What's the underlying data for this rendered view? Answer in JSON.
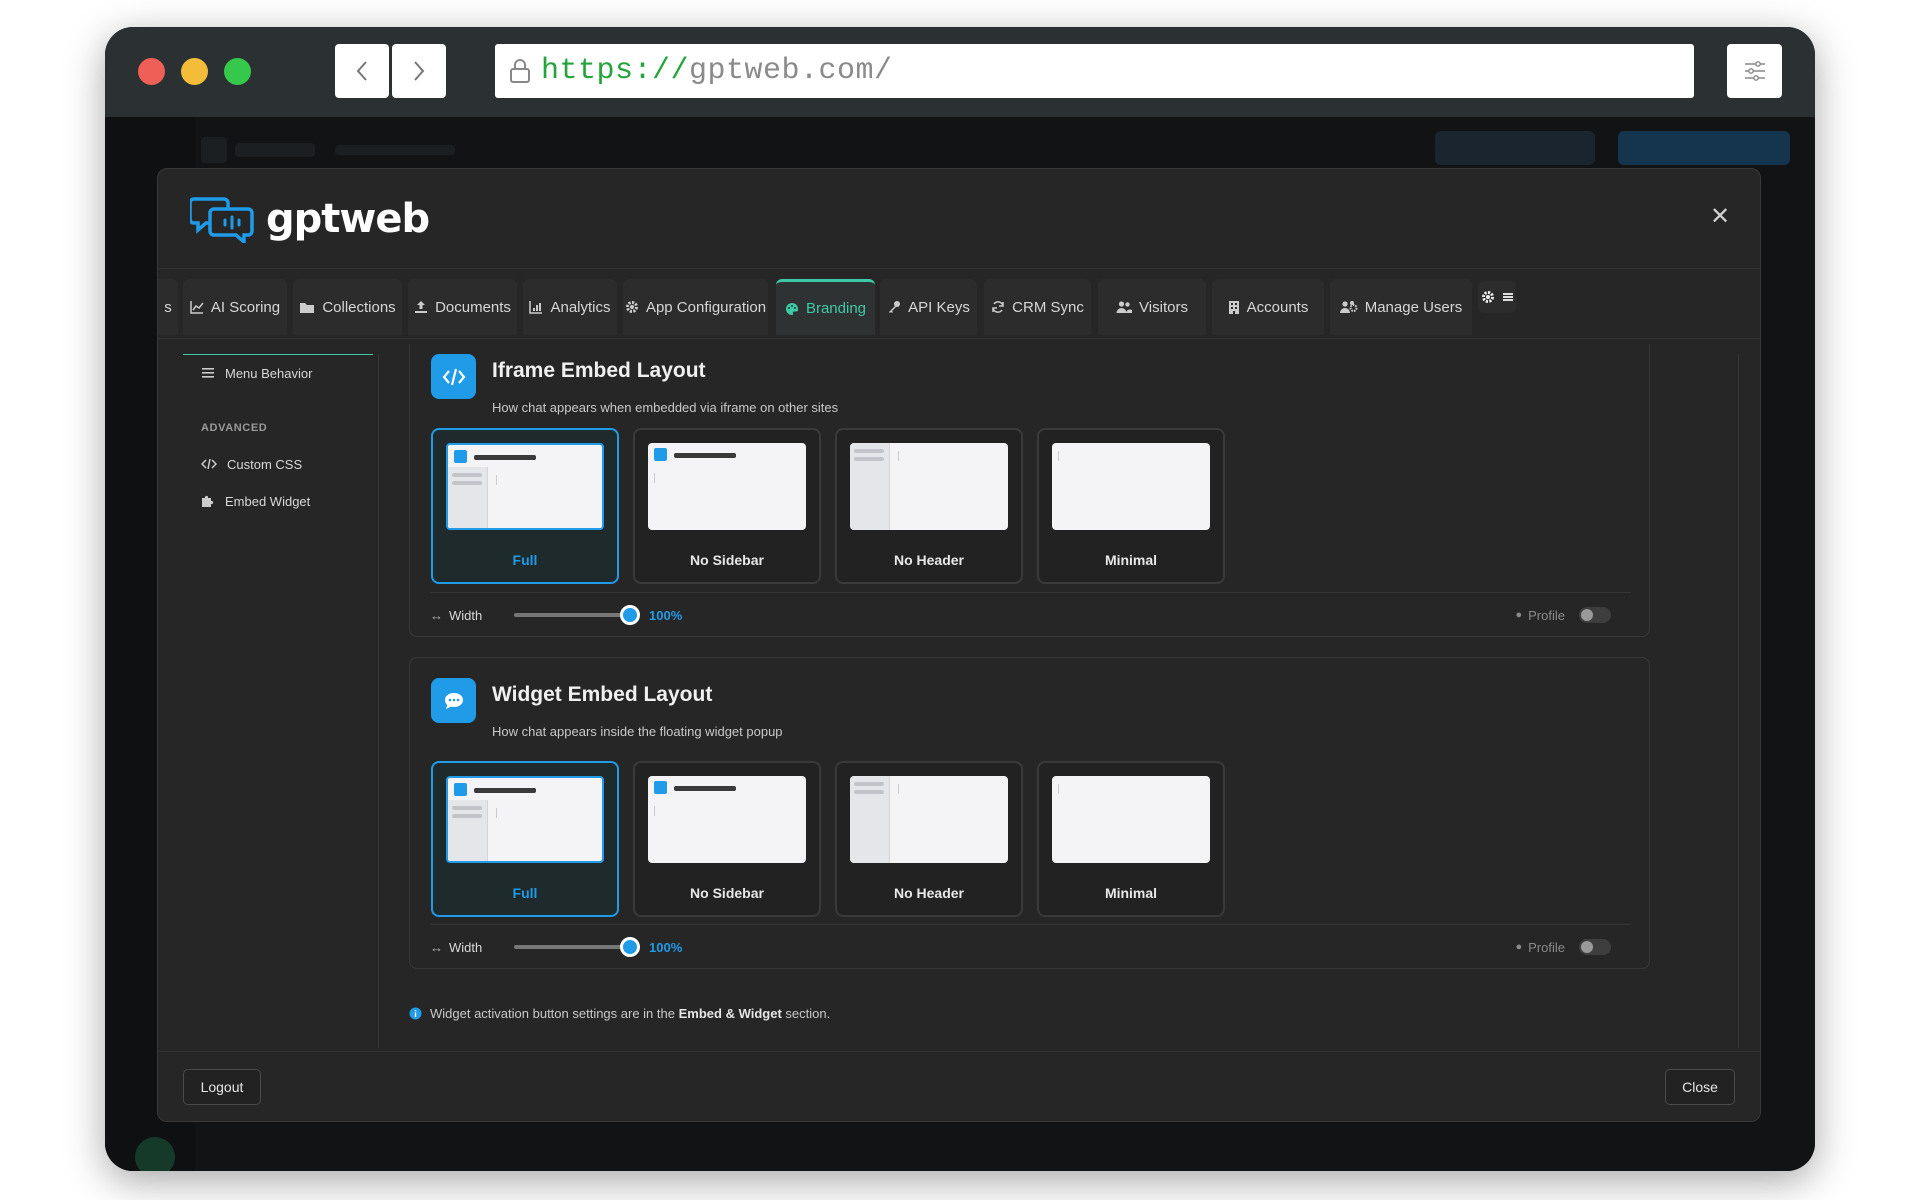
{
  "browser": {
    "url_scheme": "https://",
    "url_host": "gptweb.com/"
  },
  "modal": {
    "logo_text": "gptweb",
    "tabs": [
      {
        "label": "s",
        "icon": "overflow-icon"
      },
      {
        "label": "AI Scoring",
        "icon": "chart-line-icon"
      },
      {
        "label": "Collections",
        "icon": "folder-icon"
      },
      {
        "label": "Documents",
        "icon": "upload-icon"
      },
      {
        "label": "Analytics",
        "icon": "bar-chart-icon"
      },
      {
        "label": "App Configuration",
        "icon": "gear-icon"
      },
      {
        "label": "Branding",
        "icon": "palette-icon",
        "active": true
      },
      {
        "label": "API Keys",
        "icon": "key-icon"
      },
      {
        "label": "CRM Sync",
        "icon": "sync-icon"
      },
      {
        "label": "Visitors",
        "icon": "users-icon"
      },
      {
        "label": "Accounts",
        "icon": "building-icon"
      },
      {
        "label": "Manage Users",
        "icon": "users-gear-icon"
      }
    ],
    "sidebar": {
      "menu_behavior": "Menu Behavior",
      "advanced_heading": "ADVANCED",
      "custom_css": "Custom CSS",
      "embed_widget": "Embed Widget"
    },
    "iframe_section": {
      "title": "Iframe Embed Layout",
      "description": "How chat appears when embedded via iframe on other sites",
      "options": [
        "Full",
        "No Sidebar",
        "No Header",
        "Minimal"
      ],
      "selected": "Full",
      "width_label": "Width",
      "width_value": "100%",
      "width_fraction": 1.0,
      "profile_label": "Profile",
      "profile_on": false
    },
    "widget_section": {
      "title": "Widget Embed Layout",
      "description": "How chat appears inside the floating widget popup",
      "options": [
        "Full",
        "No Sidebar",
        "No Header",
        "Minimal"
      ],
      "selected": "Full",
      "width_label": "Width",
      "width_value": "100%",
      "width_fraction": 1.0,
      "profile_label": "Profile",
      "profile_on": false
    },
    "note": {
      "prefix": "Widget activation button settings are in the",
      "bold": "Embed & Widget",
      "suffix": "section."
    },
    "footer": {
      "logout": "Logout",
      "close": "Close"
    }
  },
  "colors": {
    "accent_blue": "#1f9be8",
    "accent_teal": "#3ec9a7",
    "modal_bg": "#262626"
  }
}
